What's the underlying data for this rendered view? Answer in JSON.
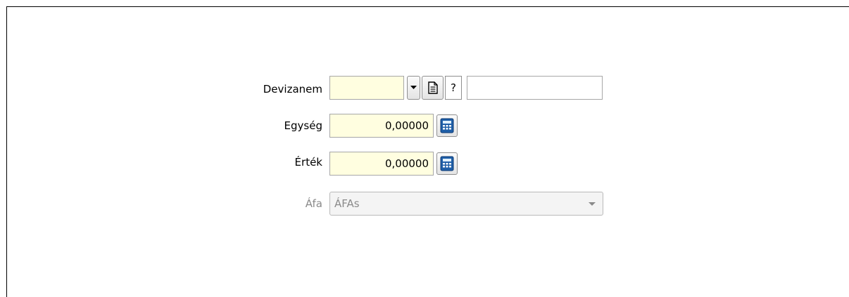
{
  "form": {
    "devizanem": {
      "label": "Devizanem",
      "value": "",
      "help": "?",
      "extra_value": ""
    },
    "egyseg": {
      "label": "Egység",
      "value": "0,00000"
    },
    "ertek": {
      "label": "Érték",
      "value": "0,00000"
    },
    "afa": {
      "label": "Áfa",
      "value": "ÁFAs"
    }
  },
  "icons": {
    "dropdown": "chevron-down-icon",
    "document": "document-icon",
    "calculator": "calculator-icon"
  },
  "colors": {
    "field_bg": "#fffee0",
    "field_border": "#a7a7a7",
    "disabled_text": "#8a8a8a",
    "calculator_blue": "#1f5fa8"
  }
}
